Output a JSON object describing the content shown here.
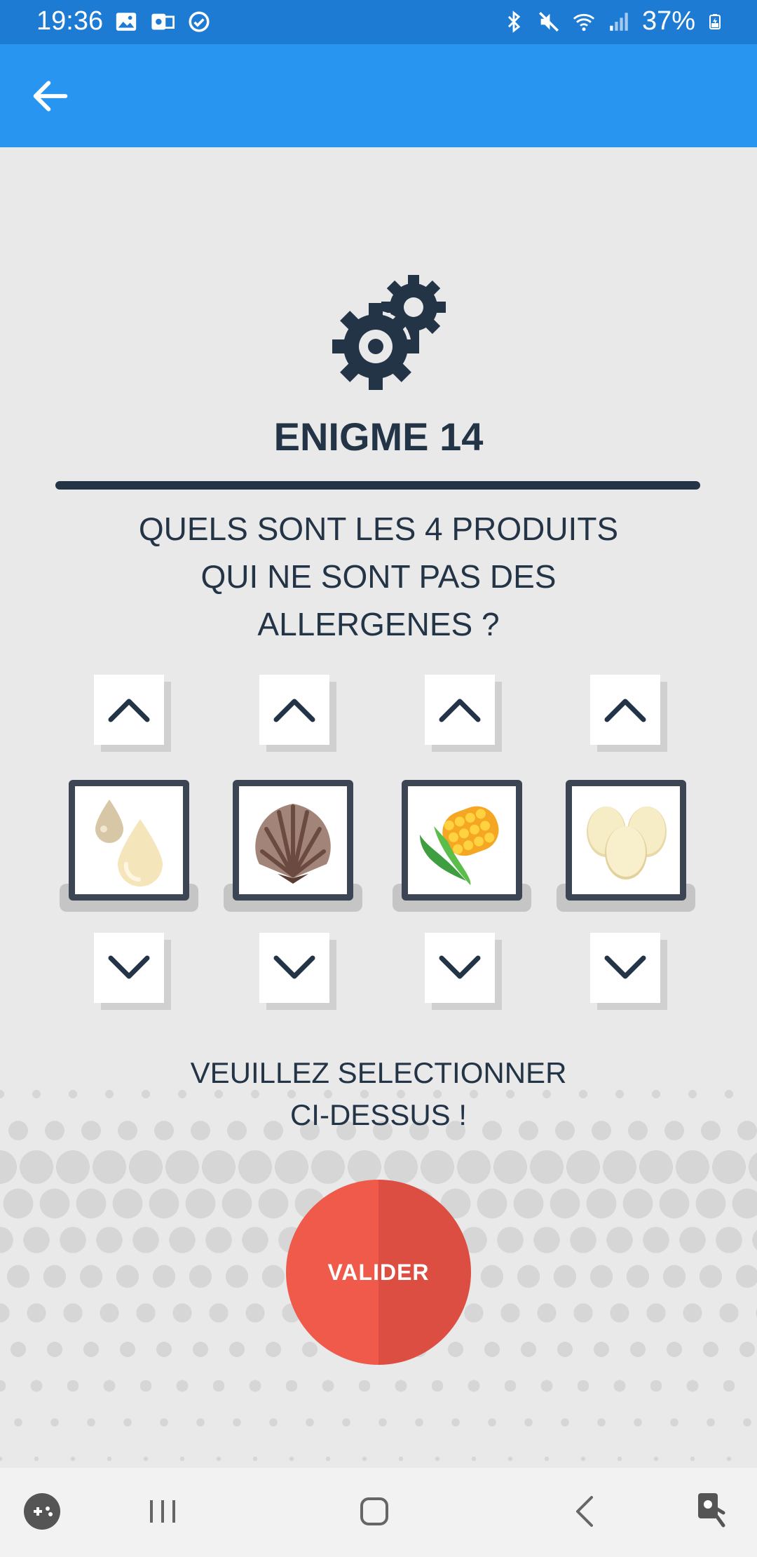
{
  "status_bar": {
    "time": "19:36",
    "battery": "37%"
  },
  "puzzle": {
    "title": "ENIGME 14",
    "question_lines": [
      "QUELS SONT LES 4 PRODUITS",
      "QUI NE SONT PAS DES",
      "ALLERGENES ?"
    ],
    "slots": [
      {
        "icon": "oil-drops-icon"
      },
      {
        "icon": "shell-icon"
      },
      {
        "icon": "corn-icon"
      },
      {
        "icon": "eggs-icon"
      }
    ],
    "instruction_lines": [
      "VEUILLEZ SELECTIONNER",
      "CI-DESSUS !"
    ],
    "validate_label": "VALIDER"
  },
  "colors": {
    "status_bar": "#1e7bd4",
    "app_bar": "#2896f0",
    "text_dark": "#243447",
    "validate_red": "#ef5a4b"
  }
}
